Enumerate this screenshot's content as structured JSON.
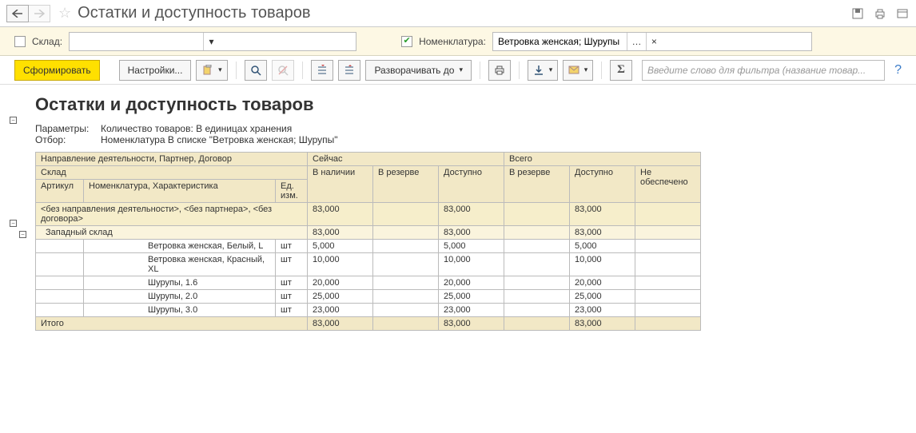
{
  "title": "Остатки и доступность товаров",
  "filters": {
    "warehouse_label": "Склад:",
    "warehouse_checked": false,
    "warehouse_value": "",
    "nomenclature_label": "Номенклатура:",
    "nomenclature_checked": true,
    "nomenclature_value": "Ветровка женская; Шурупы"
  },
  "toolbar": {
    "form": "Сформировать",
    "settings": "Настройки...",
    "expand_to": "Разворачивать до",
    "search_placeholder": "Введите слово для фильтра (название товар..."
  },
  "report": {
    "title": "Остатки и доступность товаров",
    "params_label": "Параметры:",
    "params_value": "Количество товаров: В единицах хранения",
    "filter_label": "Отбор:",
    "filter_value": "Номенклатура В списке \"Ветровка женская; Шурупы\"",
    "headers": {
      "dim_group": "Направление деятельности, Партнер, Договор",
      "warehouse": "Склад",
      "article": "Артикул",
      "nomenclature": "Номенклатура, Характеристика",
      "unit": "Ед. изм.",
      "now": "Сейчас",
      "in_stock": "В наличии",
      "reserved": "В резерве",
      "available": "Доступно",
      "total": "Всего",
      "not_provided": "Не обеспечено",
      "group1": "<без направления деятельности>, <без партнера>, <без договора>",
      "group2": "Западный склад",
      "total_row": "Итого"
    },
    "group1": {
      "in_stock": "83,000",
      "available": "83,000",
      "t_available": "83,000"
    },
    "group2": {
      "in_stock": "83,000",
      "available": "83,000",
      "t_available": "83,000"
    },
    "rows": [
      {
        "nom": "Ветровка женская, Белый, L",
        "unit": "шт",
        "in_stock": "5,000",
        "available": "5,000",
        "t_available": "5,000"
      },
      {
        "nom": "Ветровка женская, Красный, XL",
        "unit": "шт",
        "in_stock": "10,000",
        "available": "10,000",
        "t_available": "10,000"
      },
      {
        "nom": "Шурупы, 1.6",
        "unit": "шт",
        "in_stock": "20,000",
        "available": "20,000",
        "t_available": "20,000"
      },
      {
        "nom": "Шурупы, 2.0",
        "unit": "шт",
        "in_stock": "25,000",
        "available": "25,000",
        "t_available": "25,000"
      },
      {
        "nom": "Шурупы, 3.0",
        "unit": "шт",
        "in_stock": "23,000",
        "available": "23,000",
        "t_available": "23,000"
      }
    ],
    "totals": {
      "in_stock": "83,000",
      "available": "83,000",
      "t_available": "83,000"
    }
  }
}
